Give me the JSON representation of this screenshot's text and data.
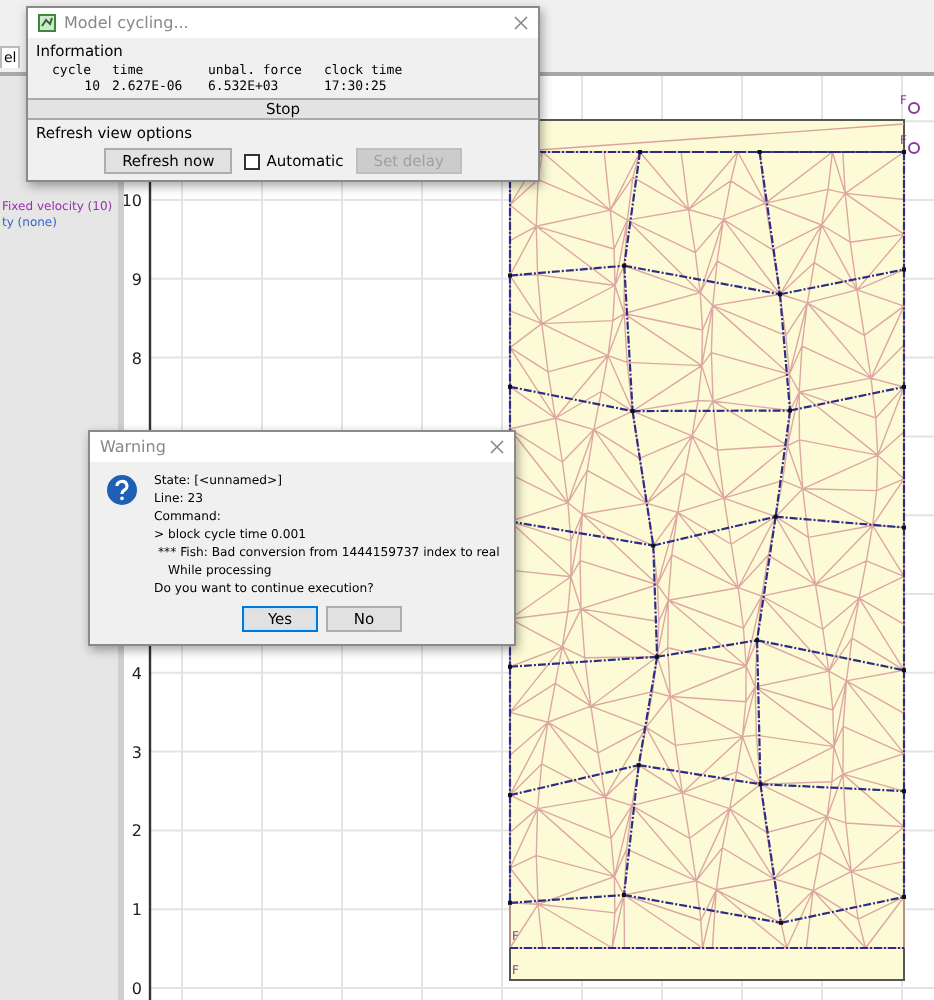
{
  "top_tab": {
    "label": "el"
  },
  "legend": [
    {
      "text": "Fixed velocity (10)",
      "color": "#9a2fb0"
    },
    {
      "text": "ty (none)",
      "color": "#3a62c8"
    }
  ],
  "plot": {
    "y_tick_labels": [
      "10",
      "9",
      "8",
      "4",
      "3",
      "2",
      "1",
      "0"
    ],
    "boundary_labels": [
      "F",
      "F",
      "F",
      "F"
    ]
  },
  "cycling_dialog": {
    "title": "Model cycling...",
    "section": "Information",
    "columns": [
      "cycle",
      "time",
      "unbal. force",
      "clock time"
    ],
    "values": [
      "10",
      "2.627E-06",
      "6.532E+03",
      "17:30:25"
    ],
    "stop_button": "Stop",
    "refresh_section": "Refresh view options",
    "refresh_button": "Refresh now",
    "automatic": {
      "label": "Automatic",
      "checked": false
    },
    "delay_button": {
      "label": "Set delay",
      "disabled": true
    }
  },
  "warning_dialog": {
    "title": "Warning",
    "lines": [
      {
        "text": "State: [<unnamed>]",
        "kind": "plain"
      },
      {
        "text": "Line: 23",
        "kind": "plain"
      },
      {
        "text": "Command:",
        "kind": "plain"
      },
      {
        "text": "> block cycle time 0.001",
        "kind": "plain"
      },
      {
        "text": "*** Fish: Bad conversion from 1444159737 index to real",
        "kind": "detail"
      },
      {
        "text": "While processing",
        "kind": "context"
      }
    ],
    "question": "Do you want to continue execution?",
    "buttons": [
      {
        "label": "Yes",
        "focused": true
      },
      {
        "label": "No",
        "focused": false
      }
    ]
  }
}
